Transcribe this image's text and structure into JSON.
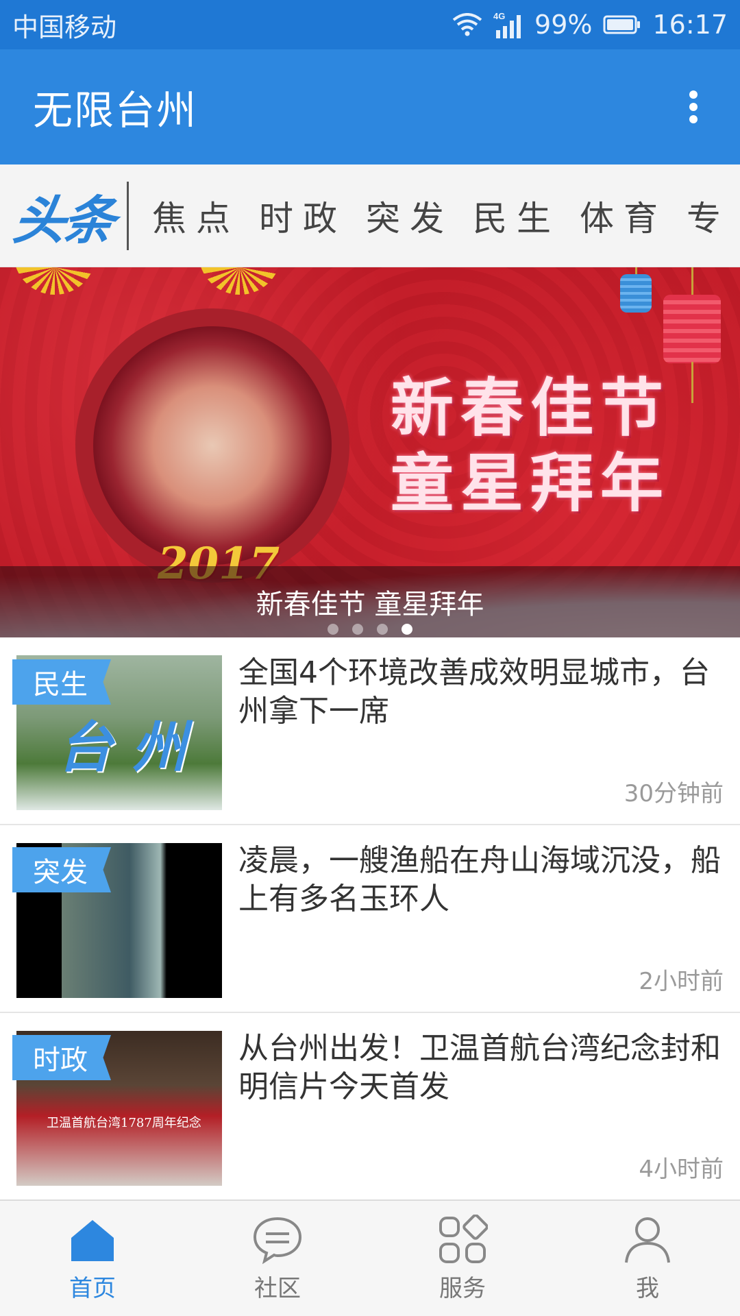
{
  "status_bar": {
    "carrier": "中国移动",
    "network": "4G",
    "battery": "99%",
    "time": "16:17"
  },
  "app_bar": {
    "title": "无限台州",
    "menu_icon": "more-vert-icon"
  },
  "tabs": {
    "logo_text": "头条",
    "items": [
      "焦点",
      "时政",
      "突发",
      "民生",
      "体育",
      "专"
    ]
  },
  "banner": {
    "art_text_line1": "新春佳节",
    "art_text_line2": "童星拜年",
    "art_year": "2017",
    "caption": "新春佳节 童星拜年",
    "slide_count": 4,
    "active_slide": 4
  },
  "news": [
    {
      "tag": "民生",
      "title": "全国4个环境改善成效明显城市，台州拿下一席",
      "time": "30分钟前",
      "thumb_text": "台 州"
    },
    {
      "tag": "突发",
      "title": "凌晨，一艘渔船在舟山海域沉没，船上有多名玉环人",
      "time": "2小时前"
    },
    {
      "tag": "时政",
      "title": "从台州出发！卫温首航台湾纪念封和明信片今天首发",
      "time": "4小时前",
      "thumb_text": "卫温首航台湾1787周年纪念"
    }
  ],
  "bottom_nav": {
    "items": [
      {
        "label": "首页",
        "icon": "home-icon",
        "active": true
      },
      {
        "label": "社区",
        "icon": "chat-bubble-icon",
        "active": false
      },
      {
        "label": "服务",
        "icon": "grid-apps-icon",
        "active": false
      },
      {
        "label": "我",
        "icon": "person-icon",
        "active": false
      }
    ]
  },
  "colors": {
    "primary": "#2d87df",
    "status_bar": "#1f78d4",
    "tag": "#4da3ec",
    "banner_red": "#c8202c"
  }
}
